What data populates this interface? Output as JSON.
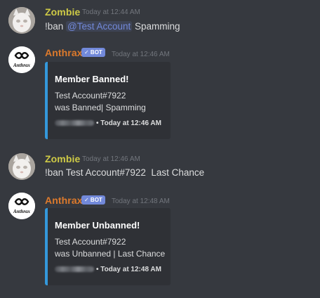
{
  "messages": [
    {
      "author": "Zombie",
      "time": "Today at 12:44 AM",
      "text_prefix": "!ban ",
      "mention": "@Test Account",
      "text_suffix": " Spamming"
    },
    {
      "author": "Anthrax",
      "badge": "✓ BOT",
      "time": "Today at 12:46 AM",
      "avatar_text": "Anthrax",
      "embed": {
        "title": "Member Banned!",
        "line1": "Test Account#7922",
        "line2": "was Banned| Spamming",
        "footer": "Today at 12:46 AM"
      }
    },
    {
      "author": "Zombie",
      "time": "Today at 12:46 AM",
      "text": "!ban Test Account#7922  Last Chance"
    },
    {
      "author": "Anthrax",
      "badge": "✓ BOT",
      "time": "Today at 12:48 AM",
      "avatar_text": "Anthrax",
      "embed": {
        "title": "Member Unbanned!",
        "line1": "Test Account#7922",
        "line2": "was Unbanned | Last Chance",
        "footer": "Today at 12:48 AM"
      }
    }
  ],
  "colors": {
    "background": "#36393f",
    "zombie_name": "#cfcb46",
    "anthrax_name": "#dd7a2c",
    "bot_badge": "#7289da",
    "embed_accent": "#3498db",
    "embed_background": "#2f3136"
  }
}
